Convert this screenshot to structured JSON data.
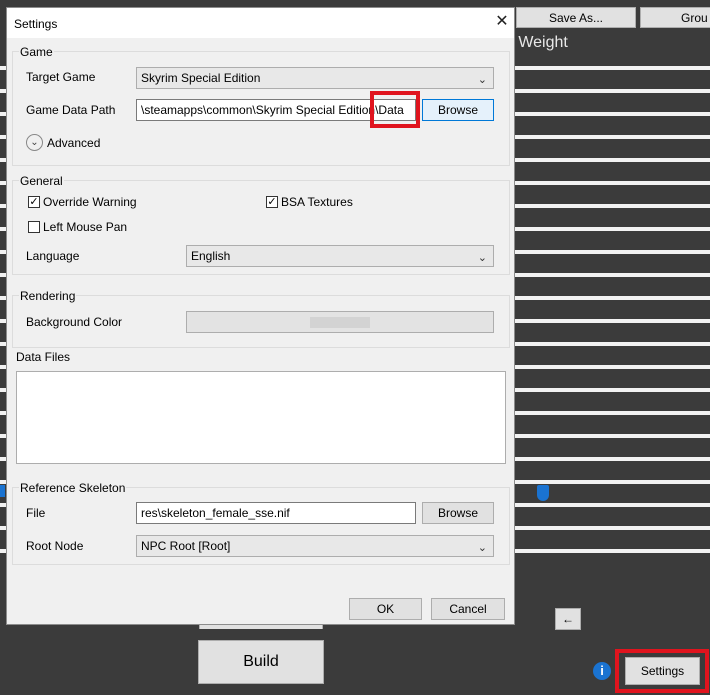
{
  "background": {
    "top_buttons": [
      {
        "label": ""
      },
      {
        "label": "Save As..."
      },
      {
        "label": "Grou"
      }
    ],
    "weight_title": "h Weight",
    "arrow_button": "←",
    "build_label": "Build",
    "info_icon": "i",
    "settings_label": "Settings"
  },
  "dialog": {
    "title": "Settings",
    "close_glyph": "✕",
    "game": {
      "group_label": "Game",
      "target_game_label": "Target Game",
      "target_game_value": "Skyrim Special Edition",
      "data_path_label": "Game Data Path",
      "data_path_value": "\\steamapps\\common\\Skyrim Special Edition\\Data",
      "browse_label": "Browse",
      "advanced_label": "Advanced"
    },
    "general": {
      "group_label": "General",
      "override_warning": {
        "label": "Override Warning",
        "checked": true
      },
      "bsa_textures": {
        "label": "BSA Textures",
        "checked": true
      },
      "left_mouse_pan": {
        "label": "Left Mouse Pan",
        "checked": false
      },
      "language_label": "Language",
      "language_value": "English"
    },
    "rendering": {
      "group_label": "Rendering",
      "background_color_label": "Background Color"
    },
    "data_files": {
      "group_label": "Data Files"
    },
    "reference_skeleton": {
      "group_label": "Reference Skeleton",
      "file_label": "File",
      "file_value": "res\\skeleton_female_sse.nif",
      "browse_label": "Browse",
      "root_node_label": "Root Node",
      "root_node_value": "NPC Root [Root]"
    },
    "ok_label": "OK",
    "cancel_label": "Cancel"
  },
  "colors": {
    "highlight": "#e0141e",
    "app_background": "#3b3b3b",
    "dialog_background": "#f0f0f0"
  }
}
